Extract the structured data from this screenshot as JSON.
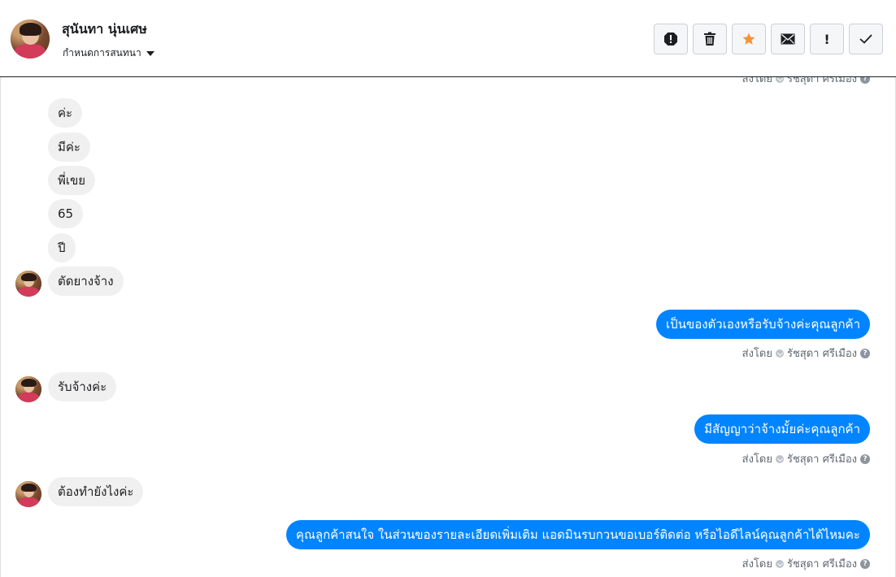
{
  "header": {
    "name": "สุนันทา นุ่นเศษ",
    "assign_label": "กำหนดการสนทนา",
    "actions": [
      {
        "icon": "spam-alert-icon"
      },
      {
        "icon": "trash-icon"
      },
      {
        "icon": "star-icon",
        "color": "#f7923b"
      },
      {
        "icon": "envelope-icon"
      },
      {
        "icon": "exclamation-icon",
        "label": "!"
      },
      {
        "icon": "check-icon"
      }
    ]
  },
  "messages": {
    "top_partial_sent": "ส่งโดย",
    "top_partial_sender": "รัชสุดา ศรีเมือง",
    "incoming_group1": [
      "ค่ะ",
      "มีค่ะ",
      "พี่เขย",
      "65",
      "ปี",
      "ตัดยางจ้าง"
    ],
    "outgoing1": "เป็นของตัวเองหรือรับจ้างค่ะคุณลูกค้า",
    "sent_by_label": "ส่งโดย",
    "sender": "รัชสุดา ศรีเมือง",
    "incoming2": "รับจ้างค่ะ",
    "outgoing2": "มีสัญญาว่าจ้างมั้ยค่ะคุณลูกค้า",
    "incoming3": "ต้องทำยังไงค่ะ",
    "outgoing3": "คุณลูกค้าสนใจ ในส่วนของรายละเอียดเพิ่มเติม แอดมินรบกวนขอเบอร์ติดต่อ หรือไอดีไลน์คุณลูกค้าได้ไหมคะ",
    "help_glyph": "?"
  },
  "colors": {
    "outgoing_bubble": "#0084ff",
    "incoming_bubble": "#f1f0f0",
    "star": "#f7923b"
  }
}
